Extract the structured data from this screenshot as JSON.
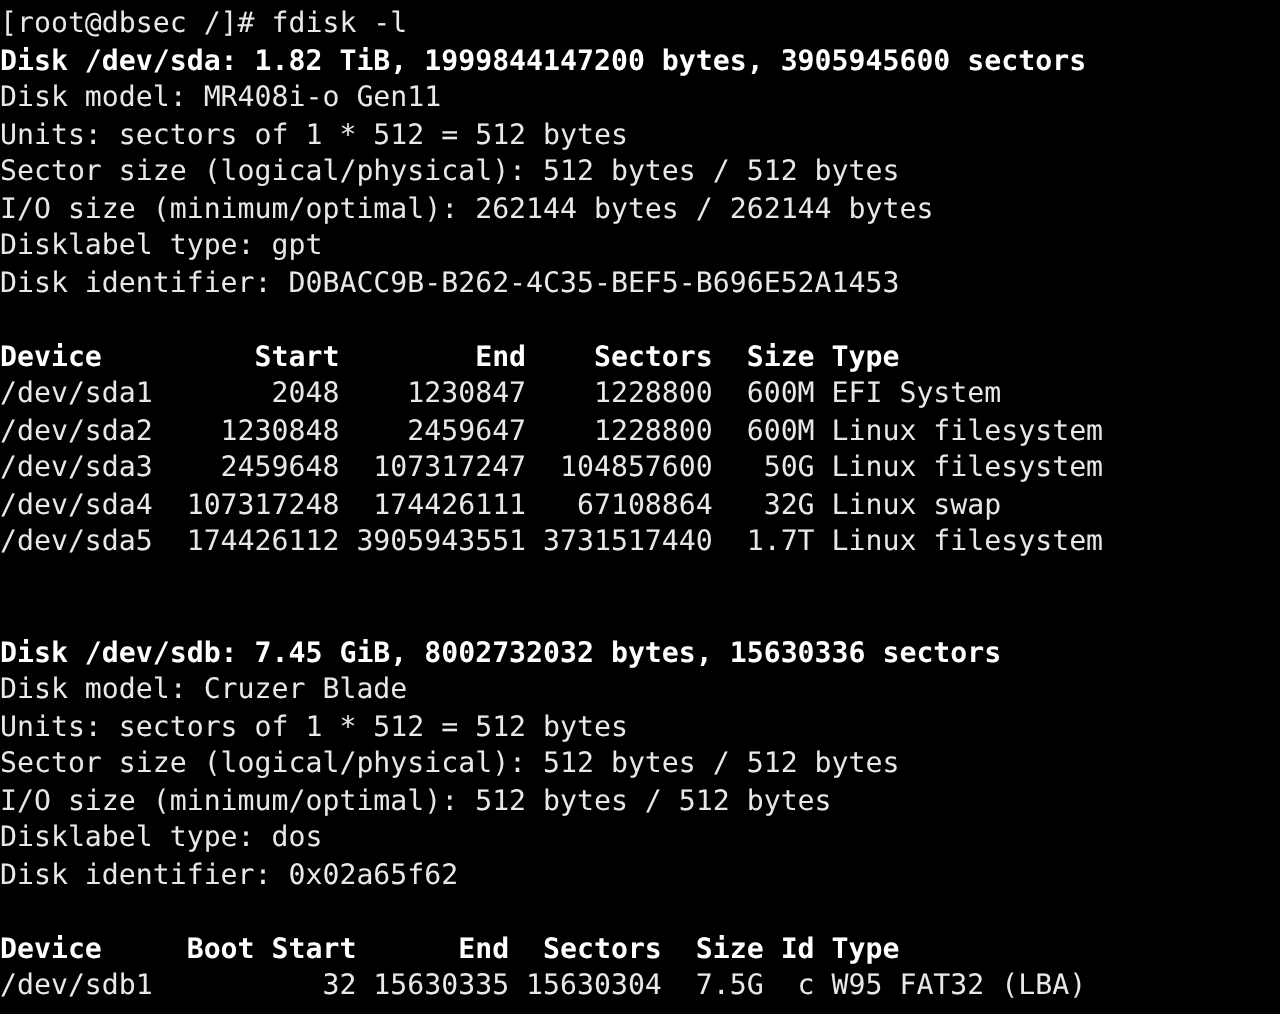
{
  "terminal": {
    "lines": [
      {
        "kind": "text",
        "text": "[root@dbsec /]# fdisk -l",
        "bold": false
      },
      {
        "kind": "text",
        "text": "Disk /dev/sda: 1.82 TiB, 1999844147200 bytes, 3905945600 sectors",
        "bold": true
      },
      {
        "kind": "text",
        "text": "Disk model: MR408i-o Gen11",
        "bold": false
      },
      {
        "kind": "text",
        "text": "Units: sectors of 1 * 512 = 512 bytes",
        "bold": false
      },
      {
        "kind": "text",
        "text": "Sector size (logical/physical): 512 bytes / 512 bytes",
        "bold": false
      },
      {
        "kind": "text",
        "text": "I/O size (minimum/optimal): 262144 bytes / 262144 bytes",
        "bold": false
      },
      {
        "kind": "text",
        "text": "Disklabel type: gpt",
        "bold": false
      },
      {
        "kind": "text",
        "text": "Disk identifier: D0BACC9B-B262-4C35-BEF5-B696E52A1453",
        "bold": false
      },
      {
        "kind": "blank"
      },
      {
        "kind": "text",
        "text": "Device         Start        End    Sectors  Size Type",
        "bold": true
      },
      {
        "kind": "text",
        "text": "/dev/sda1       2048    1230847    1228800  600M EFI System",
        "bold": false
      },
      {
        "kind": "text",
        "text": "/dev/sda2    1230848    2459647    1228800  600M Linux filesystem",
        "bold": false
      },
      {
        "kind": "text",
        "text": "/dev/sda3    2459648  107317247  104857600   50G Linux filesystem",
        "bold": false
      },
      {
        "kind": "text",
        "text": "/dev/sda4  107317248  174426111   67108864   32G Linux swap",
        "bold": false
      },
      {
        "kind": "text",
        "text": "/dev/sda5  174426112 3905943551 3731517440  1.7T Linux filesystem",
        "bold": false
      },
      {
        "kind": "blank"
      },
      {
        "kind": "blank"
      },
      {
        "kind": "text",
        "text": "Disk /dev/sdb: 7.45 GiB, 8002732032 bytes, 15630336 sectors",
        "bold": true
      },
      {
        "kind": "text",
        "text": "Disk model: Cruzer Blade",
        "bold": false
      },
      {
        "kind": "text",
        "text": "Units: sectors of 1 * 512 = 512 bytes",
        "bold": false
      },
      {
        "kind": "text",
        "text": "Sector size (logical/physical): 512 bytes / 512 bytes",
        "bold": false
      },
      {
        "kind": "text",
        "text": "I/O size (minimum/optimal): 512 bytes / 512 bytes",
        "bold": false
      },
      {
        "kind": "text",
        "text": "Disklabel type: dos",
        "bold": false
      },
      {
        "kind": "text",
        "text": "Disk identifier: 0x02a65f62",
        "bold": false
      },
      {
        "kind": "blank"
      },
      {
        "kind": "text",
        "text": "Device     Boot Start      End  Sectors  Size Id Type",
        "bold": true
      },
      {
        "kind": "text",
        "text": "/dev/sdb1          32 15630335 15630304  7.5G  c W95 FAT32 (LBA)",
        "bold": false
      }
    ]
  }
}
